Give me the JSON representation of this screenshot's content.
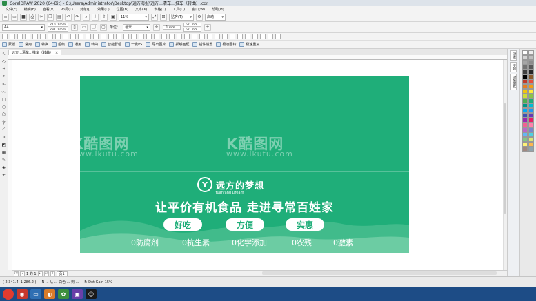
{
  "window": {
    "title": "CorelDRAW 2020 (64-Bit) - C:\\Users\\Administrator\\Desktop\\远方海报\\远方…清车…推车（转曲）.cdr"
  },
  "menu": [
    "文件(F)",
    "编辑(E)",
    "查看(V)",
    "布局(L)",
    "对象(J)",
    "效果(C)",
    "位图(B)",
    "文本(X)",
    "表格(T)",
    "工具(O)",
    "窗口(W)",
    "帮助(H)"
  ],
  "toolbar": {
    "zoom": "11%",
    "snap": "贴齐(T)",
    "launch": "启动"
  },
  "propbar": {
    "page_size": "A4",
    "width": "210.0 mm",
    "height": "297.0 mm",
    "units_label": "单位：",
    "units": "毫米",
    "nudge": ".1 mm",
    "dup_x": "5.0 mm",
    "dup_y": "5.0 mm"
  },
  "plugin_toolbar": [
    {
      "label": "蒙版"
    },
    {
      "label": "常用"
    },
    {
      "label": "转换"
    },
    {
      "label": "超级"
    },
    {
      "label": "通用"
    },
    {
      "label": "转曲"
    },
    {
      "label": "智能群组"
    },
    {
      "label": "一键PS"
    },
    {
      "label": "导出图片"
    },
    {
      "label": "拆解画框"
    },
    {
      "label": "插件设置"
    },
    {
      "label": "极速图转"
    },
    {
      "label": "极速重复"
    }
  ],
  "document_tab": "远方…清车…推车（转曲）",
  "dockers": [
    "对象",
    "变换",
    "对象属性"
  ],
  "artboard": {
    "watermark_logo": "K酷图网",
    "watermark_url": "www.ikutu.com",
    "brand_name": "远方的梦想",
    "brand_en": "Yuanfang Dream",
    "slogan": "让平价有机食品 走进寻常百姓家",
    "pills": [
      "好吃",
      "方便",
      "实惠"
    ],
    "tags": [
      "0防腐剂",
      "0抗生素",
      "0化学添加",
      "0农残",
      "0激素"
    ]
  },
  "pager": {
    "page_label": "页1",
    "page_count": "1 的 1"
  },
  "status": {
    "coords": "( 2,341.4, 1,286.2 )",
    "info": "N ... 从 ... 白色 ... 到 ...",
    "profile": "F: Dot Gain 15%"
  },
  "colors": {
    "artboard": "#1fae79",
    "accent": "#1fae79"
  }
}
